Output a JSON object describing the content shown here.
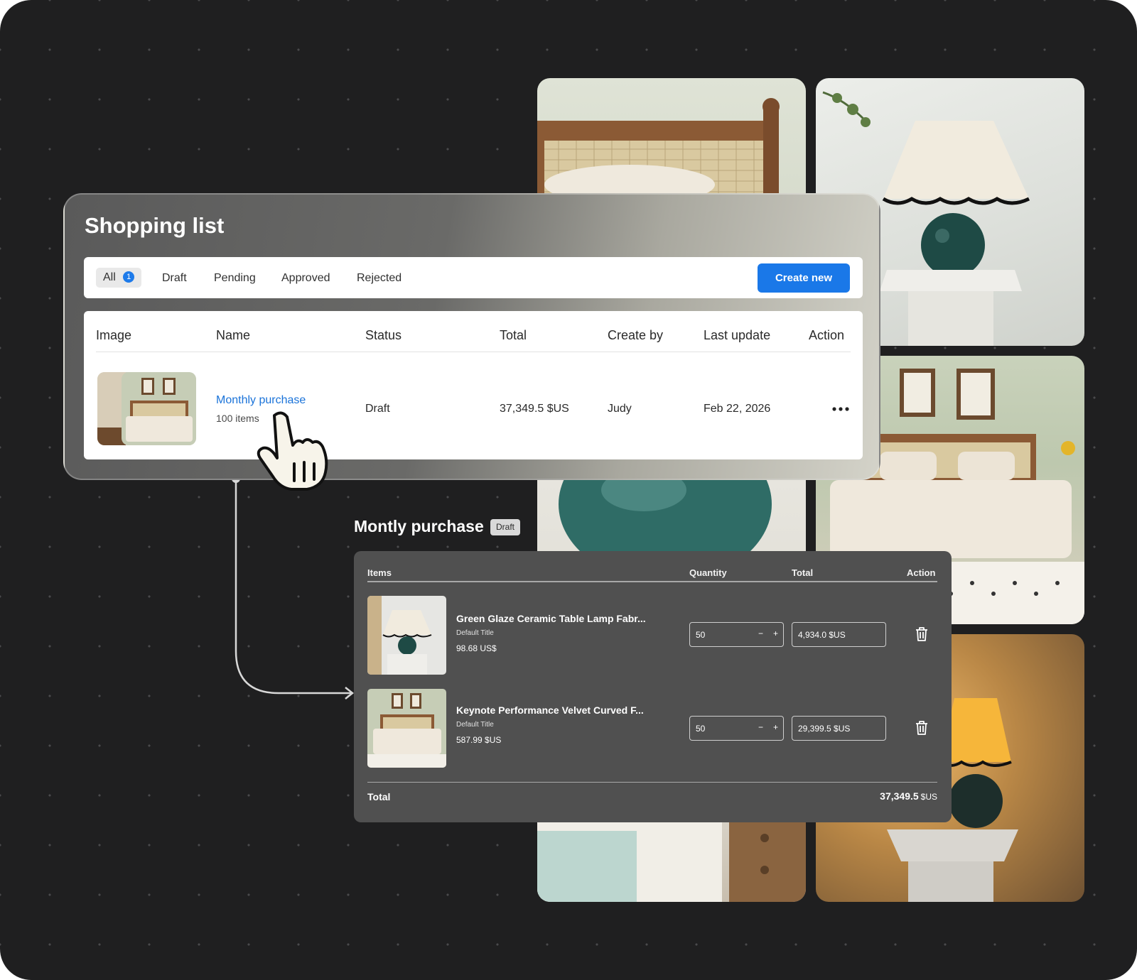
{
  "shopping_list": {
    "title": "Shopping list",
    "tabs": [
      {
        "label": "All",
        "count": "1"
      },
      {
        "label": "Draft"
      },
      {
        "label": "Pending"
      },
      {
        "label": "Approved"
      },
      {
        "label": "Rejected"
      }
    ],
    "create_label": "Create new",
    "columns": [
      "Image",
      "Name",
      "Status",
      "Total",
      "Create by",
      "Last update",
      "Action"
    ],
    "rows": [
      {
        "name": "Monthly purchase",
        "items": "100 items",
        "status": "Draft",
        "total": "37,349.5 $US",
        "created_by": "Judy",
        "last_update": "Feb 22, 2026",
        "action_icon": "more-horizontal-icon"
      }
    ]
  },
  "detail": {
    "title": "Montly purchase",
    "badge": "Draft",
    "columns": [
      "Items",
      "Quantity",
      "Total",
      "Action"
    ],
    "items": [
      {
        "name": "Green Glaze Ceramic Table Lamp Fabr...",
        "variant": "Default Title",
        "price": "98.68 US$",
        "quantity": "50",
        "total": "4,934.0 $US"
      },
      {
        "name": "Keynote Performance Velvet Curved F...",
        "variant": "Default Title",
        "price": "587.99 $US",
        "quantity": "50",
        "total": "29,399.5 $US"
      }
    ],
    "total_label": "Total",
    "total_value": "37,349.5",
    "total_unit": "$US",
    "minus": "−",
    "plus": "+"
  },
  "colors": {
    "accent": "#1a78e8",
    "link": "#1a73d9",
    "background": "#1f1f20",
    "detail_panel": "#505050"
  }
}
